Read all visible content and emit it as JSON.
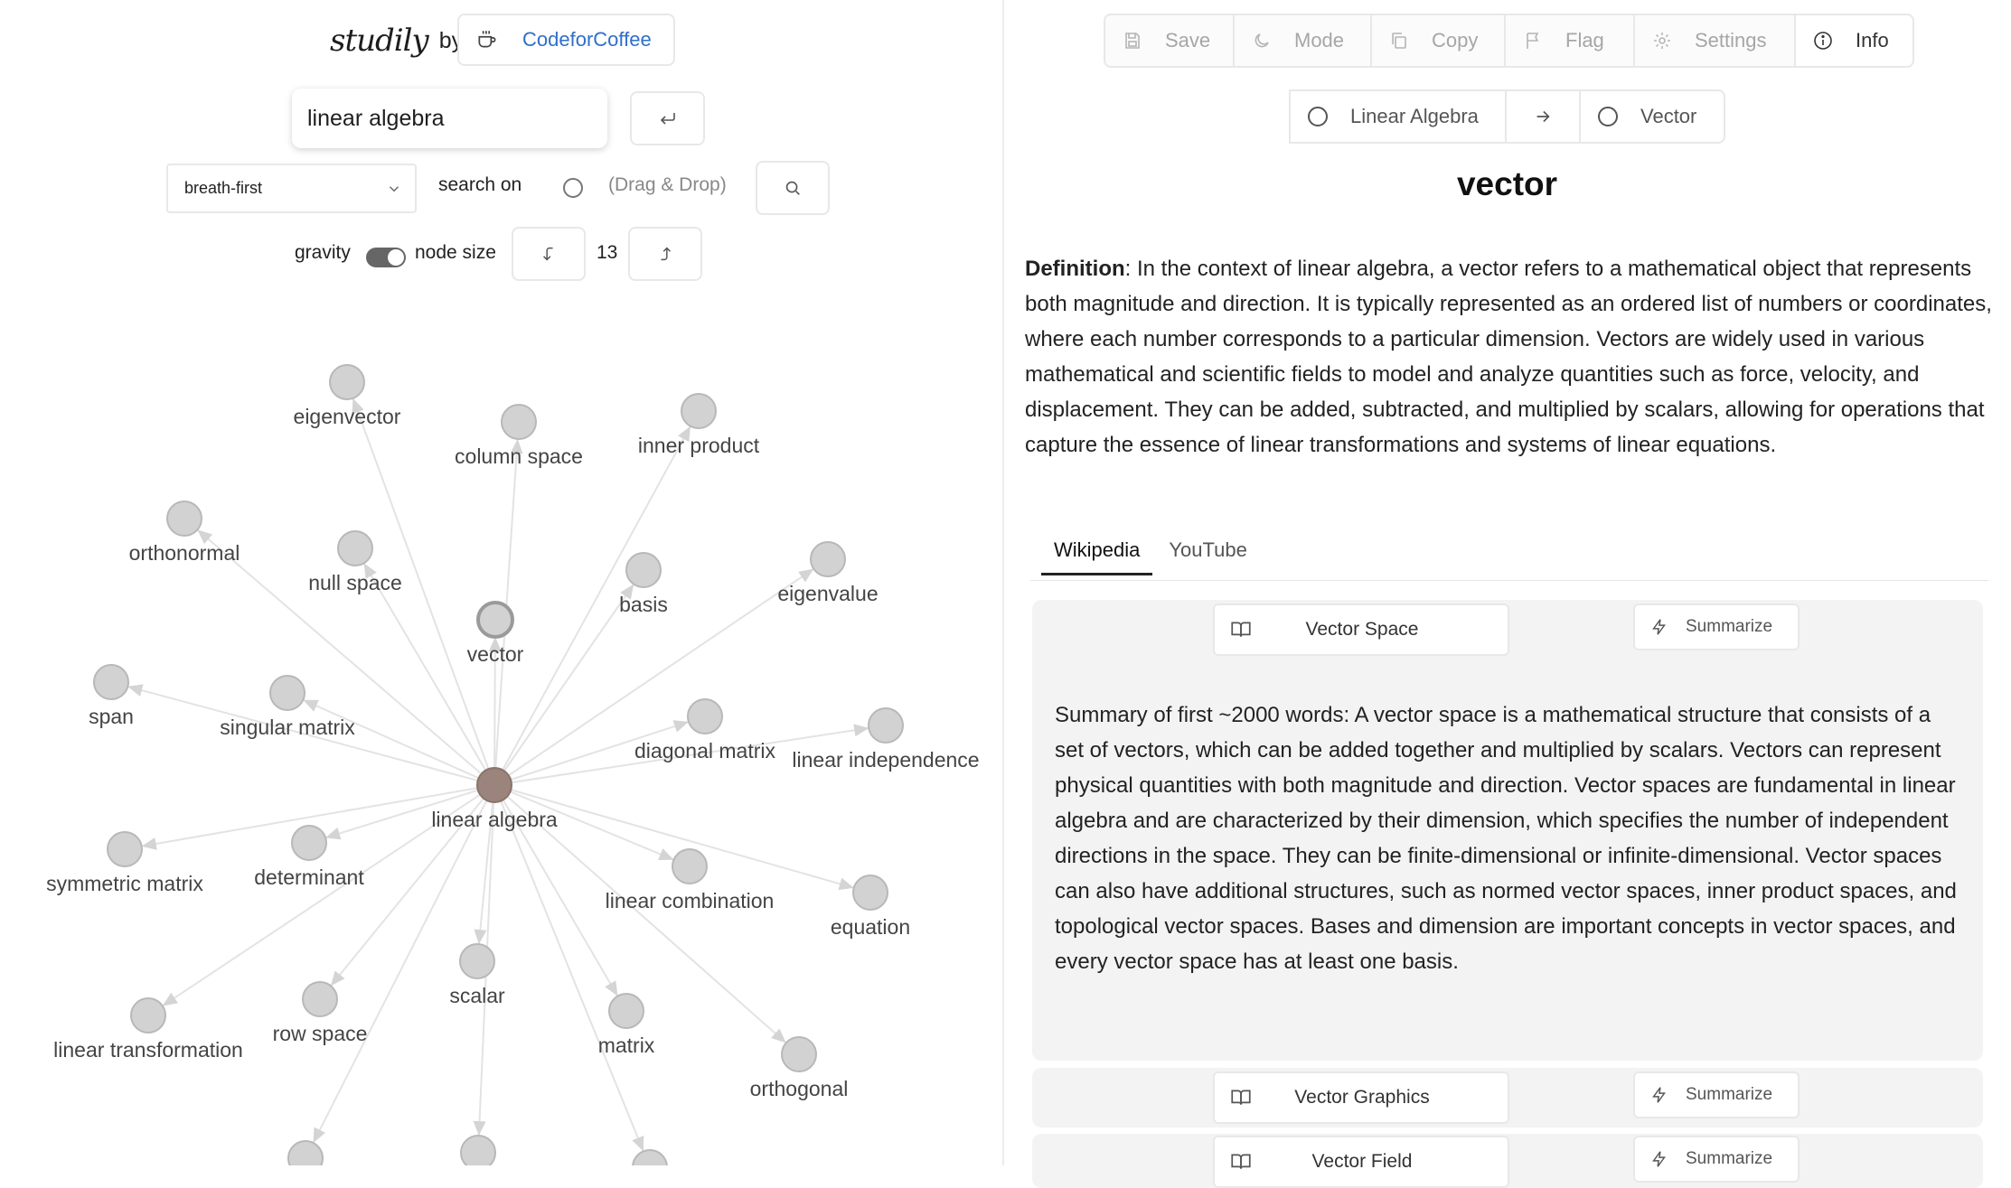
{
  "brand": {
    "logo": "studily",
    "by": "by",
    "coffee_label": "CodeforCoffee"
  },
  "search": {
    "value": "linear algebra"
  },
  "controls": {
    "algorithm": "breath-first",
    "search_on_label": "search on",
    "drag_drop_label": "(Drag & Drop)",
    "gravity_label": "gravity",
    "gravity_on": true,
    "node_size_label": "node size",
    "node_size_value": "13"
  },
  "graph": {
    "center": "linear algebra",
    "nodes": [
      "eigenvector",
      "column space",
      "inner product",
      "orthonormal",
      "null space",
      "basis",
      "eigenvalue",
      "vector",
      "span",
      "singular matrix",
      "diagonal matrix",
      "linear independence",
      "symmetric matrix",
      "determinant",
      "linear combination",
      "equation",
      "scalar",
      "linear transformation",
      "row space",
      "matrix",
      "orthogonal"
    ],
    "colors": {
      "node": "#d2d2d2",
      "node_stroke": "#b8b8b8",
      "center": "#9b847c",
      "edge": "#e3e3e3"
    }
  },
  "toolbar": {
    "items": [
      {
        "label": "Save",
        "icon": "save-icon"
      },
      {
        "label": "Mode",
        "icon": "moon-icon"
      },
      {
        "label": "Copy",
        "icon": "copy-icon"
      },
      {
        "label": "Flag",
        "icon": "flag-icon"
      },
      {
        "label": "Settings",
        "icon": "gear-icon"
      },
      {
        "label": "Info",
        "icon": "info-icon"
      }
    ]
  },
  "breadcrumb": {
    "from": "Linear Algebra",
    "to": "Vector"
  },
  "term": {
    "title": "vector",
    "definition_label": "Definition",
    "definition": ": In the context of linear algebra, a vector refers to a mathematical object that represents both magnitude and direction. It is typically represented as an ordered list of numbers or coordinates, where each number corresponds to a particular dimension. Vectors are widely used in various mathematical and scientific fields to model and analyze quantities such as force, velocity, and displacement. They can be added, subtracted, and multiplied by scalars, allowing for operations that capture the essence of linear transformations and systems of linear equations."
  },
  "tabs": [
    "Wikipedia",
    "YouTube"
  ],
  "wiki": {
    "summarize_label": "Summarize",
    "articles": [
      {
        "title": "Vector Space",
        "summary": "Summary of first ~2000 words: A vector space is a mathematical structure that consists of a set of vectors, which can be added together and multiplied by scalars. Vectors can represent physical quantities with both magnitude and direction. Vector spaces are fundamental in linear algebra and are characterized by their dimension, which specifies the number of independent directions in the space. They can be finite-dimensional or infinite-dimensional. Vector spaces can also have additional structures, such as normed vector spaces, inner product spaces, and topological vector spaces. Bases and dimension are important concepts in vector spaces, and every vector space has at least one basis."
      },
      {
        "title": "Vector Graphics"
      },
      {
        "title": "Vector Field"
      }
    ]
  }
}
